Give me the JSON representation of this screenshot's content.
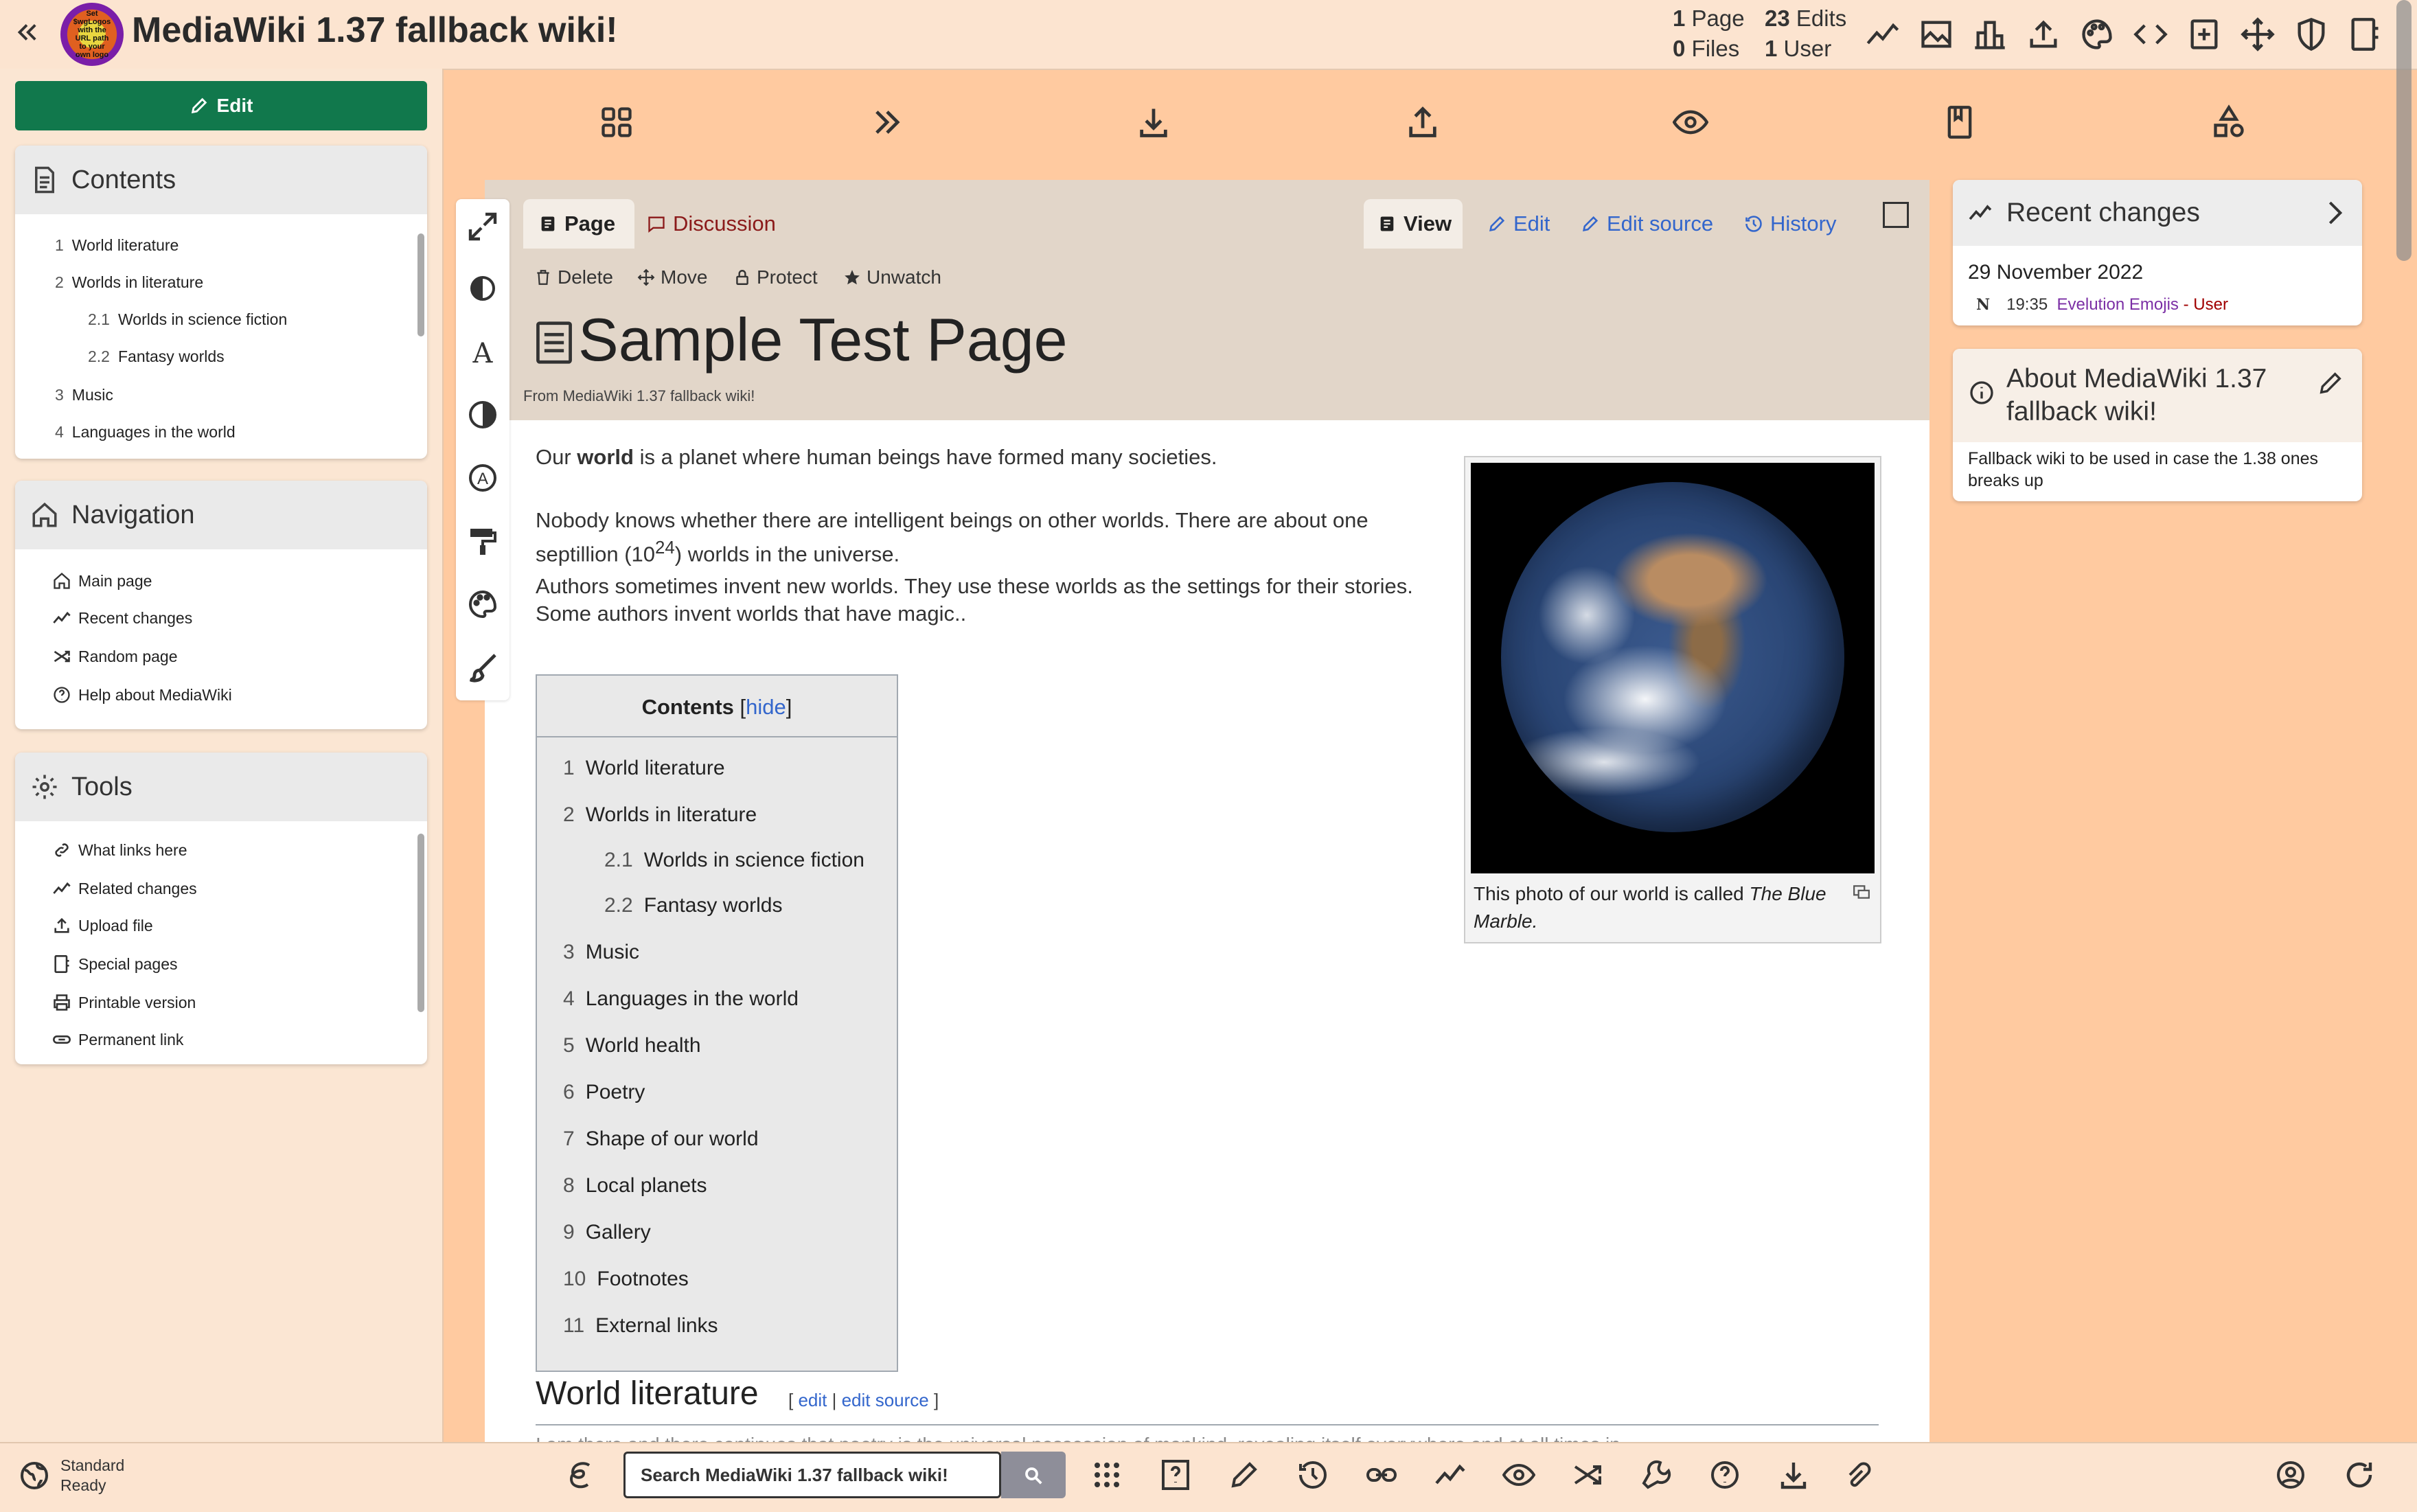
{
  "header": {
    "title": "MediaWiki 1.37 fallback wiki!",
    "logo_text": "Set $wgLogos with the URL path to your own logo",
    "stats": {
      "pages_count": "1",
      "pages_label": "Page",
      "edits_count": "23",
      "edits_label": "Edits",
      "files_count": "0",
      "files_label": "Files",
      "users_count": "1",
      "users_label": "User"
    },
    "icons": [
      "recent-changes-icon",
      "upload-image-icon",
      "statistics-icon",
      "upload-icon",
      "theme-palette-icon",
      "code-icon",
      "new-page-icon",
      "move-icon",
      "shield-icon",
      "special-pages-icon"
    ]
  },
  "sidebar": {
    "edit_label": "Edit",
    "contents": {
      "title": "Contents",
      "items": [
        {
          "num": "1",
          "label": "World literature"
        },
        {
          "num": "2",
          "label": "Worlds in literature"
        },
        {
          "num": "2.1",
          "label": "Worlds in science fiction"
        },
        {
          "num": "2.2",
          "label": "Fantasy worlds"
        },
        {
          "num": "3",
          "label": "Music"
        },
        {
          "num": "4",
          "label": "Languages in the world"
        }
      ]
    },
    "navigation": {
      "title": "Navigation",
      "items": [
        {
          "label": "Main page",
          "icon": "home-icon"
        },
        {
          "label": "Recent changes",
          "icon": "recent-changes-icon"
        },
        {
          "label": "Random page",
          "icon": "shuffle-icon"
        },
        {
          "label": "Help about MediaWiki",
          "icon": "help-icon"
        }
      ]
    },
    "tools": {
      "title": "Tools",
      "items": [
        {
          "label": "What links here",
          "icon": "link-icon"
        },
        {
          "label": "Related changes",
          "icon": "related-changes-icon"
        },
        {
          "label": "Upload file",
          "icon": "upload-icon"
        },
        {
          "label": "Special pages",
          "icon": "special-pages-icon"
        },
        {
          "label": "Printable version",
          "icon": "printer-icon"
        },
        {
          "label": "Permanent link",
          "icon": "permanent-link-icon"
        }
      ]
    }
  },
  "page_actions": [
    "grid-icon",
    "double-chevron-right-icon",
    "download-icon",
    "share-upload-icon",
    "eye-icon",
    "bookmark-icon",
    "shapes-icon"
  ],
  "tool_strip": [
    "expand-icon",
    "contrast-icon",
    "font-icon",
    "dark-mode-icon",
    "accessibility-icon",
    "paint-roller-icon",
    "palette-icon",
    "brush-icon"
  ],
  "tabs": {
    "page": "Page",
    "discussion": "Discussion",
    "view": "View",
    "edit": "Edit",
    "edit_source": "Edit source",
    "history": "History"
  },
  "actions": {
    "delete": "Delete",
    "move": "Move",
    "protect": "Protect",
    "unwatch": "Unwatch"
  },
  "article": {
    "title": "Sample Test Page",
    "from": "From MediaWiki 1.37 fallback wiki!",
    "p1_pre": "Our ",
    "p1_bold": "world",
    "p1_post": " is a planet where human beings have formed many societies.",
    "p2_pre": "Nobody knows whether there are intelligent beings on other worlds. There are about one septillion (10",
    "p2_sup": "24",
    "p2_post": ") worlds in the universe.",
    "p3": "Authors sometimes invent new worlds. They use these worlds as the settings for their stories. Some authors invent worlds that have magic..",
    "caption_pre": "This photo of our world is called ",
    "caption_em": "The Blue Marble.",
    "toc": {
      "title": "Contents",
      "hide": "hide",
      "items": [
        {
          "num": "1",
          "label": "World literature"
        },
        {
          "num": "2",
          "label": "Worlds in literature"
        },
        {
          "num": "2.1",
          "label": "Worlds in science fiction"
        },
        {
          "num": "2.2",
          "label": "Fantasy worlds"
        },
        {
          "num": "3",
          "label": "Music"
        },
        {
          "num": "4",
          "label": "Languages in the world"
        },
        {
          "num": "5",
          "label": "World health"
        },
        {
          "num": "6",
          "label": "Poetry"
        },
        {
          "num": "7",
          "label": "Shape of our world"
        },
        {
          "num": "8",
          "label": "Local planets"
        },
        {
          "num": "9",
          "label": "Gallery"
        },
        {
          "num": "10",
          "label": "Footnotes"
        },
        {
          "num": "11",
          "label": "External links"
        }
      ]
    },
    "section1": {
      "heading": "World literature",
      "edit": "edit",
      "edit_source": "edit source",
      "faded_text": "I am there and there continues that poetry is the universal possession of mankind, revealing itself everywhere and at all times in"
    }
  },
  "recent_changes": {
    "title": "Recent changes",
    "date": "29 November 2022",
    "entry_flag": "N",
    "entry_time": "19:35",
    "entry_page": "Evelution Emojis",
    "entry_sep": " - ",
    "entry_user": "User"
  },
  "about": {
    "title": "About MediaWiki 1.37 fallback wiki!",
    "text": "Fallback wiki to be used in case the 1.38 ones breaks up"
  },
  "bottom": {
    "status_line1": "Standard",
    "status_line2": "Ready",
    "search_placeholder": "Search MediaWiki 1.37 fallback wiki!"
  },
  "colors": {
    "background": "#ffcaa0",
    "edit_button": "#11784c",
    "link": "#3366cc",
    "discussion": "#8b1a1a",
    "user_link": "#a00000",
    "page_link": "#7b2fa5"
  }
}
